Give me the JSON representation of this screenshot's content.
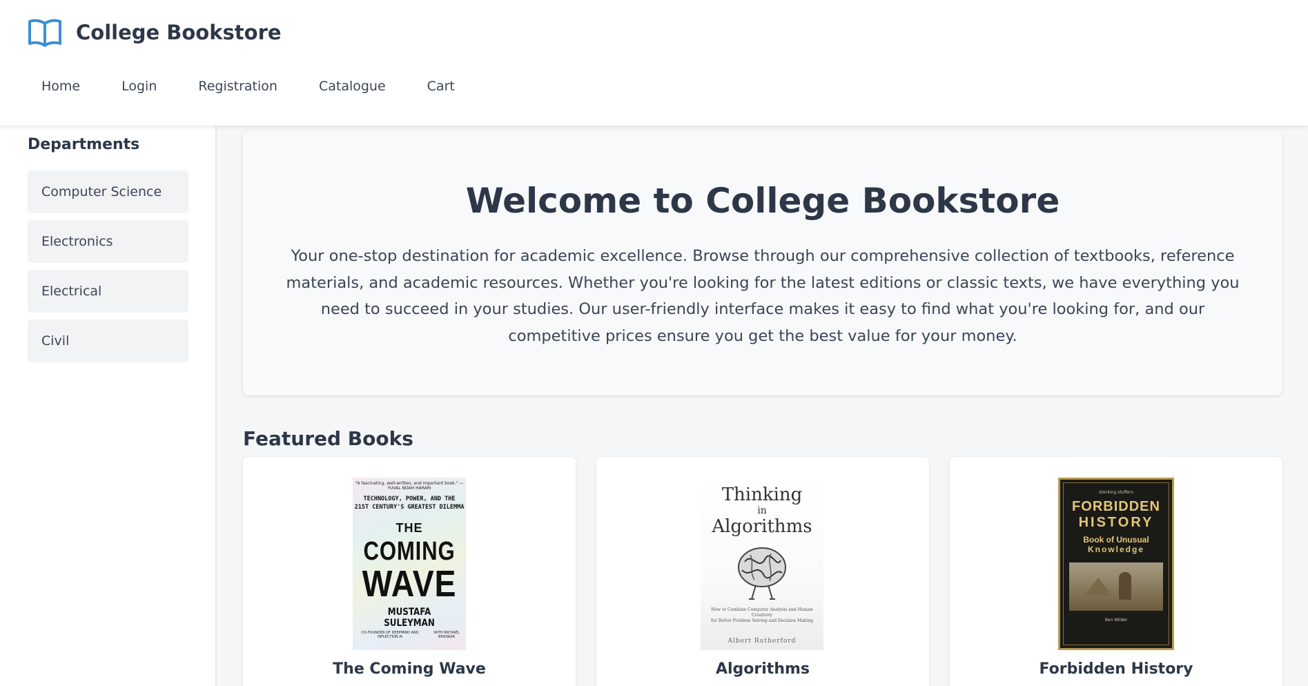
{
  "header": {
    "brand_icon": "open-book-icon",
    "brand_title": "College Bookstore",
    "nav": [
      "Home",
      "Login",
      "Registration",
      "Catalogue",
      "Cart"
    ]
  },
  "sidebar": {
    "heading": "Departments",
    "items": [
      "Computer Science",
      "Electronics",
      "Electrical",
      "Civil"
    ]
  },
  "hero": {
    "title": "Welcome to College Bookstore",
    "text": "Your one-stop destination for academic excellence. Browse through our comprehensive collection of textbooks, reference materials, and academic resources. Whether you're looking for the latest editions or classic texts, we have everything you need to succeed in your studies. Our user-friendly interface makes it easy to find what you're looking for, and our competitive prices ensure you get the best value for your money."
  },
  "featured": {
    "heading": "Featured Books",
    "books": [
      {
        "title": "The Coming Wave",
        "cover": {
          "quote": "\"A fascinating, well-written, and important book.\" —YUVAL NOAH HARARI",
          "subtitle_1": "TECHNOLOGY, POWER, AND THE",
          "subtitle_2": "21ST CENTURY'S GREATEST DILEMMA",
          "line_1": "THE",
          "line_2": "COMING",
          "line_3": "WAVE",
          "author": "MUSTAFA SULEYMAN",
          "credit_left": "CO-FOUNDER OF DEEPMIND AND INFLECTION AI",
          "credit_right": "WITH MICHAEL BHASKAR"
        }
      },
      {
        "title": "Algorithms",
        "cover": {
          "line_1": "Thinking",
          "line_2": "in",
          "line_3": "Algorithms",
          "tagline_1": "How to Combine Computer Analysis and Human Creativity",
          "tagline_2": "for Better Problem Solving and Decision Making",
          "author": "Albert Rutherford"
        }
      },
      {
        "title": "Forbidden History",
        "cover": {
          "kicker": "stocking stuffers",
          "line_1": "FORBIDDEN",
          "line_2": "HISTORY",
          "line_3": "Book of Unusual",
          "line_4": "Knowledge",
          "author": "Ben Wilder"
        }
      }
    ]
  }
}
